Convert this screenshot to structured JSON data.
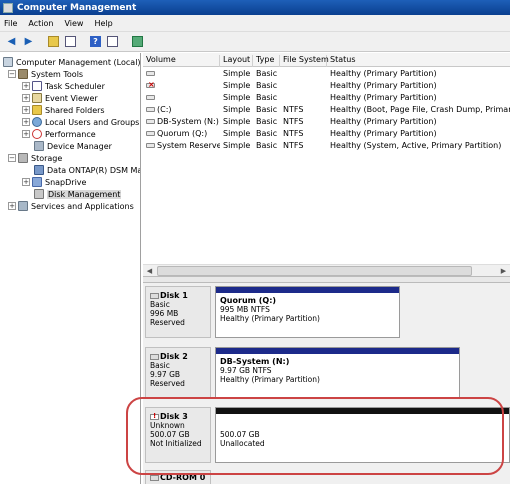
{
  "window": {
    "title": "Computer Management"
  },
  "menu": [
    "File",
    "Action",
    "View",
    "Help"
  ],
  "tree": {
    "root": "Computer Management (Local)",
    "system_tools": "System Tools",
    "task_scheduler": "Task Scheduler",
    "event_viewer": "Event Viewer",
    "shared_folders": "Shared Folders",
    "local_users": "Local Users and Groups",
    "performance": "Performance",
    "device_manager": "Device Manager",
    "storage": "Storage",
    "data_ontap": "Data ONTAP(R) DSM Manc",
    "snapdrive": "SnapDrive",
    "disk_management": "Disk Management",
    "services": "Services and Applications"
  },
  "volume_list": {
    "columns": [
      "Volume",
      "Layout",
      "Type",
      "File System",
      "Status"
    ],
    "rows": [
      {
        "volume": "",
        "layout": "Simple",
        "type": "Basic",
        "fs": "",
        "status": "Healthy (Primary Partition)"
      },
      {
        "volume": "",
        "layout": "Simple",
        "type": "Basic",
        "fs": "",
        "status": "Healthy (Primary Partition)"
      },
      {
        "volume": "",
        "layout": "Simple",
        "type": "Basic",
        "fs": "",
        "status": "Healthy (Primary Partition)"
      },
      {
        "volume": "(C:)",
        "layout": "Simple",
        "type": "Basic",
        "fs": "NTFS",
        "status": "Healthy (Boot, Page File, Crash Dump, Primary Part"
      },
      {
        "volume": "DB-System (N:)",
        "layout": "Simple",
        "type": "Basic",
        "fs": "NTFS",
        "status": "Healthy (Primary Partition)"
      },
      {
        "volume": "Quorum (Q:)",
        "layout": "Simple",
        "type": "Basic",
        "fs": "NTFS",
        "status": "Healthy (Primary Partition)"
      },
      {
        "volume": "System Reserved",
        "layout": "Simple",
        "type": "Basic",
        "fs": "NTFS",
        "status": "Healthy (System, Active, Primary Partition)"
      }
    ]
  },
  "disks": [
    {
      "name": "Disk 1",
      "type": "Basic",
      "size": "996 MB",
      "state": "Reserved",
      "partition": {
        "name": "Quorum  (Q:)",
        "detail": "995 MB NTFS",
        "status": "Healthy (Primary Partition)"
      }
    },
    {
      "name": "Disk 2",
      "type": "Basic",
      "size": "9.97 GB",
      "state": "Reserved",
      "partition": {
        "name": "DB-System  (N:)",
        "detail": "9.97 GB NTFS",
        "status": "Healthy (Primary Partition)"
      }
    },
    {
      "name": "Disk 3",
      "type": "Unknown",
      "size": "500.07 GB",
      "state": "Not Initialized",
      "partition": {
        "name": "",
        "detail": "500.07 GB",
        "status": "Unallocated"
      }
    },
    {
      "name": "CD-ROM 0"
    }
  ]
}
